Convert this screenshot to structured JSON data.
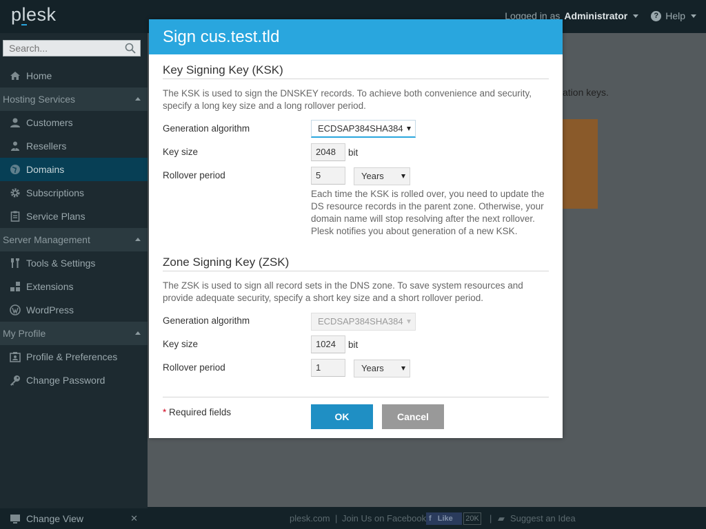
{
  "header": {
    "logo": "plesk",
    "logged_in_as": "Logged in as",
    "user": "Administrator",
    "help": "Help"
  },
  "sidebar": {
    "search_placeholder": "Search...",
    "home": "Home",
    "sections": {
      "hosting": "Hosting Services",
      "server": "Server Management",
      "profile": "My Profile"
    },
    "hosting_items": [
      "Customers",
      "Resellers",
      "Domains",
      "Subscriptions",
      "Service Plans"
    ],
    "server_items": [
      "Tools & Settings",
      "Extensions",
      "WordPress"
    ],
    "profile_items": [
      "Profile & Preferences",
      "Change Password"
    ],
    "active": "Domains",
    "change_view": "Change View"
  },
  "main": {
    "partial_text": "ation keys."
  },
  "footer": {
    "site": "plesk.com",
    "facebook": "Join Us on Facebook",
    "like": "Like",
    "like_count": "20K",
    "suggest": "Suggest an Idea"
  },
  "modal": {
    "title": "Sign cus.test.tld",
    "ksk": {
      "title": "Key Signing Key (KSK)",
      "description": "The KSK is used to sign the DNSKEY records. To achieve both convenience and security, specify a long key size and a long rollover period.",
      "algorithm_label": "Generation algorithm",
      "algorithm_value": "ECDSAP384SHA384",
      "key_size_label": "Key size",
      "key_size_value": "2048",
      "key_size_unit": "bit",
      "rollover_label": "Rollover period",
      "rollover_value": "5",
      "rollover_unit": "Years",
      "hint": "Each time the KSK is rolled over, you need to update the DS resource records in the parent zone. Otherwise, your domain name will stop resolving after the next rollover. Plesk notifies you about generation of a new KSK."
    },
    "zsk": {
      "title": "Zone Signing Key (ZSK)",
      "description": "The ZSK is used to sign all record sets in the DNS zone. To save system resources and provide adequate security, specify a short key size and a short rollover period.",
      "algorithm_label": "Generation algorithm",
      "algorithm_value": "ECDSAP384SHA384",
      "key_size_label": "Key size",
      "key_size_value": "1024",
      "key_size_unit": "bit",
      "rollover_label": "Rollover period",
      "rollover_value": "1",
      "rollover_unit": "Years"
    },
    "required_star": "*",
    "required_text": "Required fields",
    "ok": "OK",
    "cancel": "Cancel"
  }
}
